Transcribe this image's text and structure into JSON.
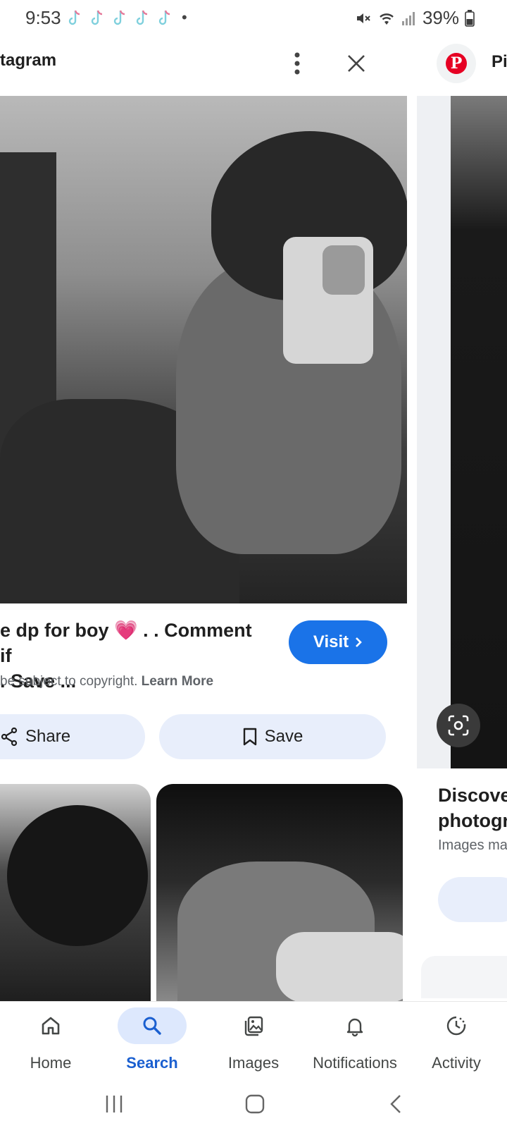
{
  "status_bar": {
    "time": "9:53",
    "battery": "39%",
    "notification_icons": [
      "tiktok-icon",
      "tiktok-icon",
      "tiktok-icon",
      "tiktok-icon",
      "tiktok-icon"
    ],
    "dot": "•"
  },
  "header": {
    "source_title": "tagram",
    "side_source_title": "Pi"
  },
  "result": {
    "caption": "e dp for boy 💗 . . Comment if\n. Save ...",
    "visit_label": "Visit",
    "copyright_prefix": " be subject to copyright. ",
    "learn_more": "Learn More",
    "share_label": "Share",
    "save_label": "Save"
  },
  "side_result": {
    "title": "Discover\nphotogra",
    "subtitle": "Images ma"
  },
  "bottom_nav": {
    "items": [
      {
        "label": "Home",
        "icon": "home-icon",
        "active": false
      },
      {
        "label": "Search",
        "icon": "search-icon",
        "active": true
      },
      {
        "label": "Images",
        "icon": "images-icon",
        "active": false
      },
      {
        "label": "Notifications",
        "icon": "bell-icon",
        "active": false
      },
      {
        "label": "Activity",
        "icon": "activity-icon",
        "active": false
      }
    ]
  },
  "colors": {
    "accent": "#1a73e8",
    "pill": "#e8eefb",
    "pinterest": "#e60023"
  }
}
